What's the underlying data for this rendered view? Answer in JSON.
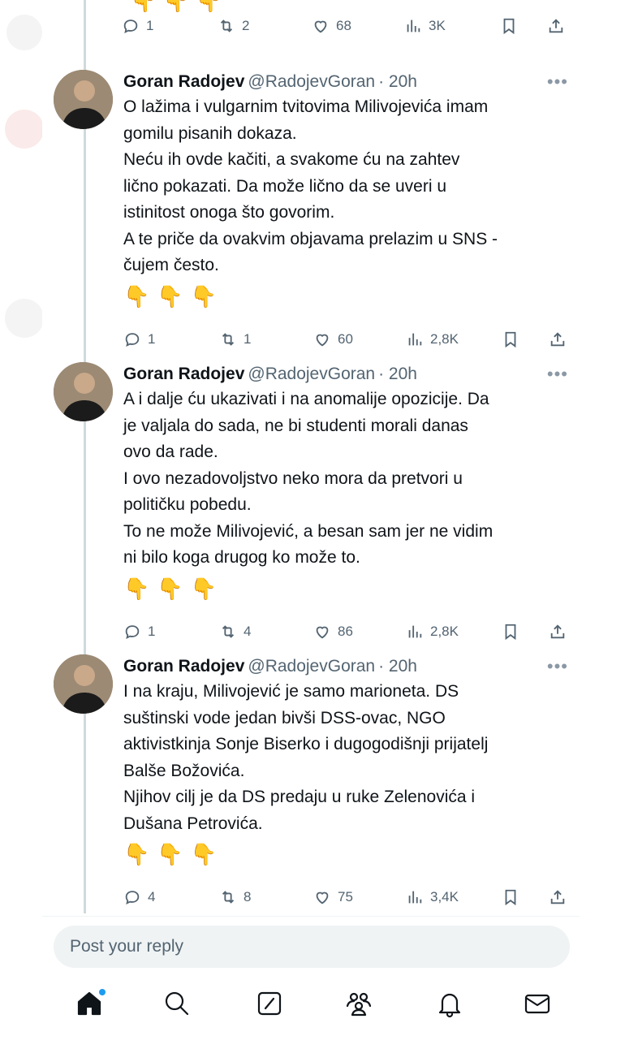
{
  "top_actions": {
    "replies": "1",
    "reposts": "2",
    "likes": "68",
    "views": "3K",
    "emojis": "👇👇👇"
  },
  "tweets": [
    {
      "name": "Goran Radojev",
      "handle": "@RadojevGoran",
      "time": "· 20h",
      "text": "O lažima i vulgarnim tvitovima Milivojevića imam\ngomilu pisanih dokaza.\nNeću ih ovde kačiti, a svakome ću na zahtev\nlično pokazati. Da može lično da se uveri u\nistinitost onoga što govorim.\nA te priče da ovakvim objavama prelazim u SNS -\nčujem često.",
      "emojis": "👇👇👇",
      "replies": "1",
      "reposts": "1",
      "likes": "60",
      "views": "2,8K"
    },
    {
      "name": "Goran Radojev",
      "handle": "@RadojevGoran",
      "time": "· 20h",
      "text": "A i dalje ću ukazivati i na anomalije opozicije. Da\nje valjala do sada, ne bi studenti morali danas\novo da rade.\nI ovo nezadovoljstvo neko mora da pretvori u\npolitičku pobedu.\nTo ne može Milivojević, a besan sam jer ne vidim\nni bilo koga drugog ko može to.",
      "emojis": "👇👇👇",
      "replies": "1",
      "reposts": "4",
      "likes": "86",
      "views": "2,8K"
    },
    {
      "name": "Goran Radojev",
      "handle": "@RadojevGoran",
      "time": "· 20h",
      "text": "I na kraju, Milivojević je samo marioneta. DS\nsuštinski vode jedan bivši DSS-ovac, NGO\naktivistkinja Sonje Biserko i dugogodišnji prijatelj\nBalše Božovića.\nNjihov cilj je da DS predaju u ruke Zelenovića i\nDušana Petrovića.",
      "emojis": "👇👇👇",
      "replies": "4",
      "reposts": "8",
      "likes": "75",
      "views": "3,4K"
    }
  ],
  "reply_bar": {
    "placeholder": "Post your reply"
  },
  "nav": [
    "home-icon",
    "search-icon",
    "grok-icon",
    "communities-icon",
    "notifications-icon",
    "messages-icon"
  ],
  "colors": {
    "accent": "#1d9bf0",
    "text": "#0f1419",
    "muted": "#536471",
    "line": "#cfd9de"
  }
}
